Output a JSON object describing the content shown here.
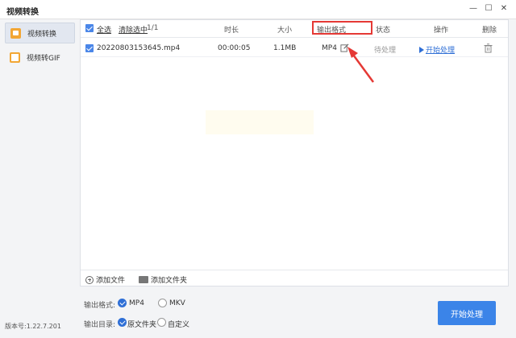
{
  "window": {
    "title": "视频转换",
    "min_glyph": "—",
    "max_glyph": "☐",
    "close_glyph": "✕"
  },
  "sidebar": {
    "items": [
      {
        "label": "视频转换",
        "icon": "video-convert-icon",
        "active": true
      },
      {
        "label": "视频转GIF",
        "icon": "gif-icon",
        "active": false
      }
    ],
    "version": "版本号:1.22.7.201"
  },
  "table": {
    "select_all": "全选",
    "clear_selected": "清除选中",
    "count": "1/1",
    "columns": {
      "duration": "时长",
      "size": "大小",
      "output_format": "输出格式",
      "status": "状态",
      "action": "操作",
      "delete": "删除"
    },
    "rows": [
      {
        "filename": "20220803153645.mp4",
        "duration": "00:00:05",
        "size": "1.1MB",
        "format": "MP4",
        "status": "待处理",
        "action": "开始处理"
      }
    ]
  },
  "footer": {
    "add_file": "添加文件",
    "add_folder": "添加文件夹"
  },
  "options": {
    "format_label": "输出格式:",
    "format_options": [
      "MP4",
      "MKV"
    ],
    "format_selected": "MP4",
    "dir_label": "输出目录:",
    "dir_options": [
      "原文件夹",
      "自定义"
    ],
    "dir_selected": "原文件夹"
  },
  "primary_button": "开始处理",
  "colors": {
    "accent": "#3b84e8",
    "highlight": "#e53935"
  }
}
